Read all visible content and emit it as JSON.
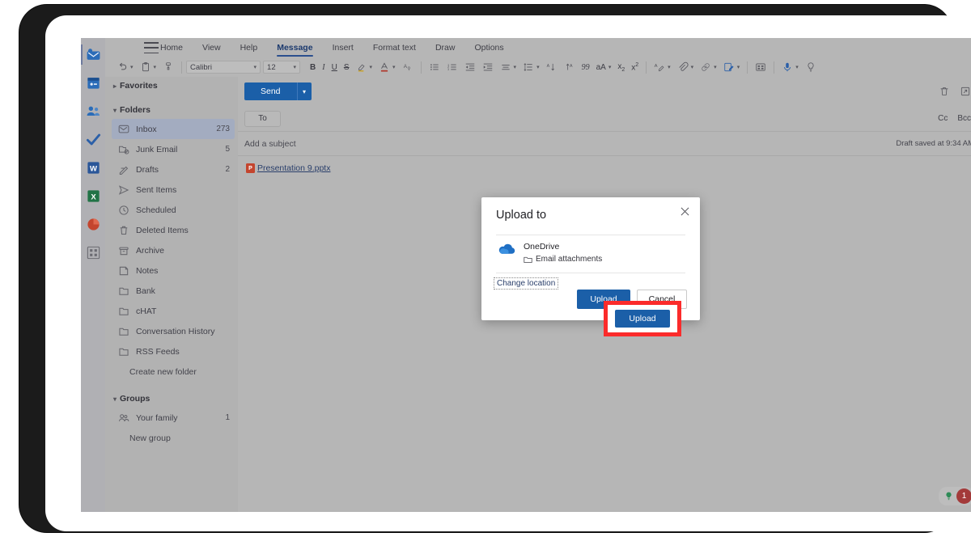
{
  "app_rail": [
    {
      "name": "mail-app-icon",
      "label": "Mail",
      "color": "#2b6cb8",
      "active": true
    },
    {
      "name": "calendar-app-icon",
      "label": "Calendar",
      "color": "#2b6cb8",
      "active": false
    },
    {
      "name": "people-app-icon",
      "label": "People",
      "color": "#2b6cb8",
      "active": false
    },
    {
      "name": "todo-app-icon",
      "label": "To Do",
      "color": "#2b5fa8",
      "active": false
    },
    {
      "name": "word-app-icon",
      "label": "Word",
      "color": "#2a5699",
      "active": false
    },
    {
      "name": "excel-app-icon",
      "label": "Excel",
      "color": "#217346",
      "active": false
    },
    {
      "name": "powerpoint-app-icon",
      "label": "PowerPoint",
      "color": "#c4452e",
      "active": false
    },
    {
      "name": "apps-grid-icon",
      "label": "Apps",
      "color": "#6b6b72",
      "active": false
    }
  ],
  "ribbon": {
    "menu_icon": "hamburger-icon",
    "tabs": [
      {
        "label": "Home",
        "active": false
      },
      {
        "label": "View",
        "active": false
      },
      {
        "label": "Help",
        "active": false
      },
      {
        "label": "Message",
        "active": true
      },
      {
        "label": "Insert",
        "active": false
      },
      {
        "label": "Format text",
        "active": false
      },
      {
        "label": "Draw",
        "active": false
      },
      {
        "label": "Options",
        "active": false
      }
    ],
    "font_name": "Calibri",
    "font_size": "12",
    "bold_label": "B",
    "italic_label": "I",
    "underline_label": "U",
    "strikethrough_label": "S",
    "quote_label": "99",
    "case_label": "aA",
    "subscript_label": "x",
    "superscript_label": "x"
  },
  "sidebar": {
    "favorites": {
      "label": "Favorites",
      "expanded": false
    },
    "folders_header": {
      "label": "Folders",
      "expanded": true
    },
    "folders": [
      {
        "label": "Inbox",
        "count": "273",
        "icon": "inbox-icon",
        "selected": true
      },
      {
        "label": "Junk Email",
        "count": "5",
        "icon": "junk-icon",
        "selected": false
      },
      {
        "label": "Drafts",
        "count": "2",
        "icon": "drafts-icon",
        "selected": false
      },
      {
        "label": "Sent Items",
        "count": "",
        "icon": "send-icon",
        "selected": false
      },
      {
        "label": "Scheduled",
        "count": "",
        "icon": "clock-icon",
        "selected": false
      },
      {
        "label": "Deleted Items",
        "count": "",
        "icon": "trash-icon",
        "selected": false
      },
      {
        "label": "Archive",
        "count": "",
        "icon": "archive-icon",
        "selected": false
      },
      {
        "label": "Notes",
        "count": "",
        "icon": "note-icon",
        "selected": false
      },
      {
        "label": "Bank",
        "count": "",
        "icon": "folder-icon",
        "selected": false
      },
      {
        "label": "cHAT",
        "count": "",
        "icon": "folder-icon",
        "selected": false
      },
      {
        "label": "Conversation History",
        "count": "",
        "icon": "folder-icon",
        "selected": false
      },
      {
        "label": "RSS Feeds",
        "count": "",
        "icon": "folder-icon",
        "selected": false
      }
    ],
    "create_new_folder": "Create new folder",
    "groups_header": {
      "label": "Groups",
      "expanded": true
    },
    "groups": [
      {
        "label": "Your family",
        "count": "1",
        "icon": "group-icon"
      }
    ],
    "new_group": "New group"
  },
  "compose": {
    "send_label": "Send",
    "send_caret_icon": "chevron-down-icon",
    "discard_icon": "trash-icon",
    "popout_icon": "popout-icon",
    "to_label": "To",
    "to_value": "",
    "cc_label": "Cc",
    "bcc_label": "Bcc",
    "subject_placeholder": "Add a subject",
    "draft_status": "Draft saved at 9:34 AM",
    "attachment": {
      "file_name": "Presentation 9.pptx",
      "icon": "powerpoint-file-icon",
      "icon_glyph": "P"
    }
  },
  "status_bar": {
    "tips_icon": "lightbulb-icon",
    "notification_count": "1"
  },
  "dialog": {
    "title": "Upload to",
    "close_icon": "close-icon",
    "destination_icon": "onedrive-icon",
    "destination_name": "OneDrive",
    "destination_folder": "Email attachments",
    "folder_icon": "folder-icon",
    "change_location_label": "Change location",
    "upload_label": "Upload",
    "cancel_label": "Cancel",
    "primary_color": "#1b5fa8",
    "highlight_color": "#fb2b2b"
  }
}
